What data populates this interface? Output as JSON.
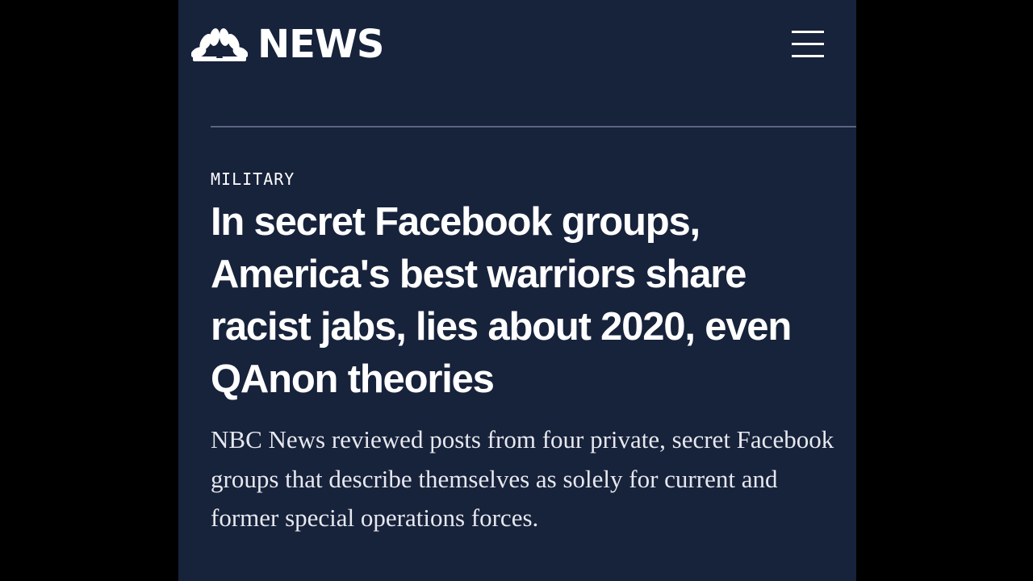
{
  "header": {
    "logo_icon": "nbc-peacock-icon",
    "logo_text": "NEWS",
    "menu_icon": "hamburger-menu-icon"
  },
  "article": {
    "category": "MILITARY",
    "headline": "In secret Facebook groups, America's best warriors share racist jabs, lies about 2020, even QAnon theories",
    "dek": "NBC News reviewed posts from four private, secret Facebook groups that describe themselves as solely for current and former special operations forces."
  },
  "colors": {
    "page_background": "#17223b",
    "letterbox": "#000000",
    "text": "#ffffff",
    "divider": "#5c6580"
  }
}
